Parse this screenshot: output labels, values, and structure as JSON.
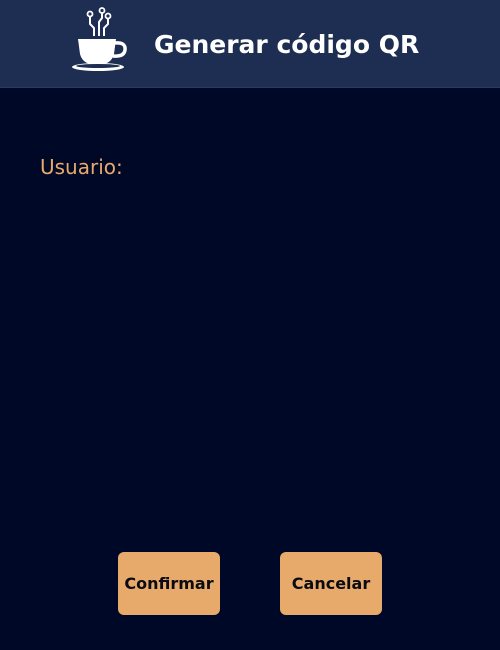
{
  "header": {
    "title": "Generar código QR",
    "logo_icon": "coffee-cup-icon"
  },
  "form": {
    "user_label": "Usuario:"
  },
  "buttons": {
    "confirm_label": "Confirmar",
    "cancel_label": "Cancelar"
  },
  "colors": {
    "background": "#000828",
    "header": "#1e2e52",
    "accent": "#e8aa6b",
    "label": "#e8a96a"
  }
}
